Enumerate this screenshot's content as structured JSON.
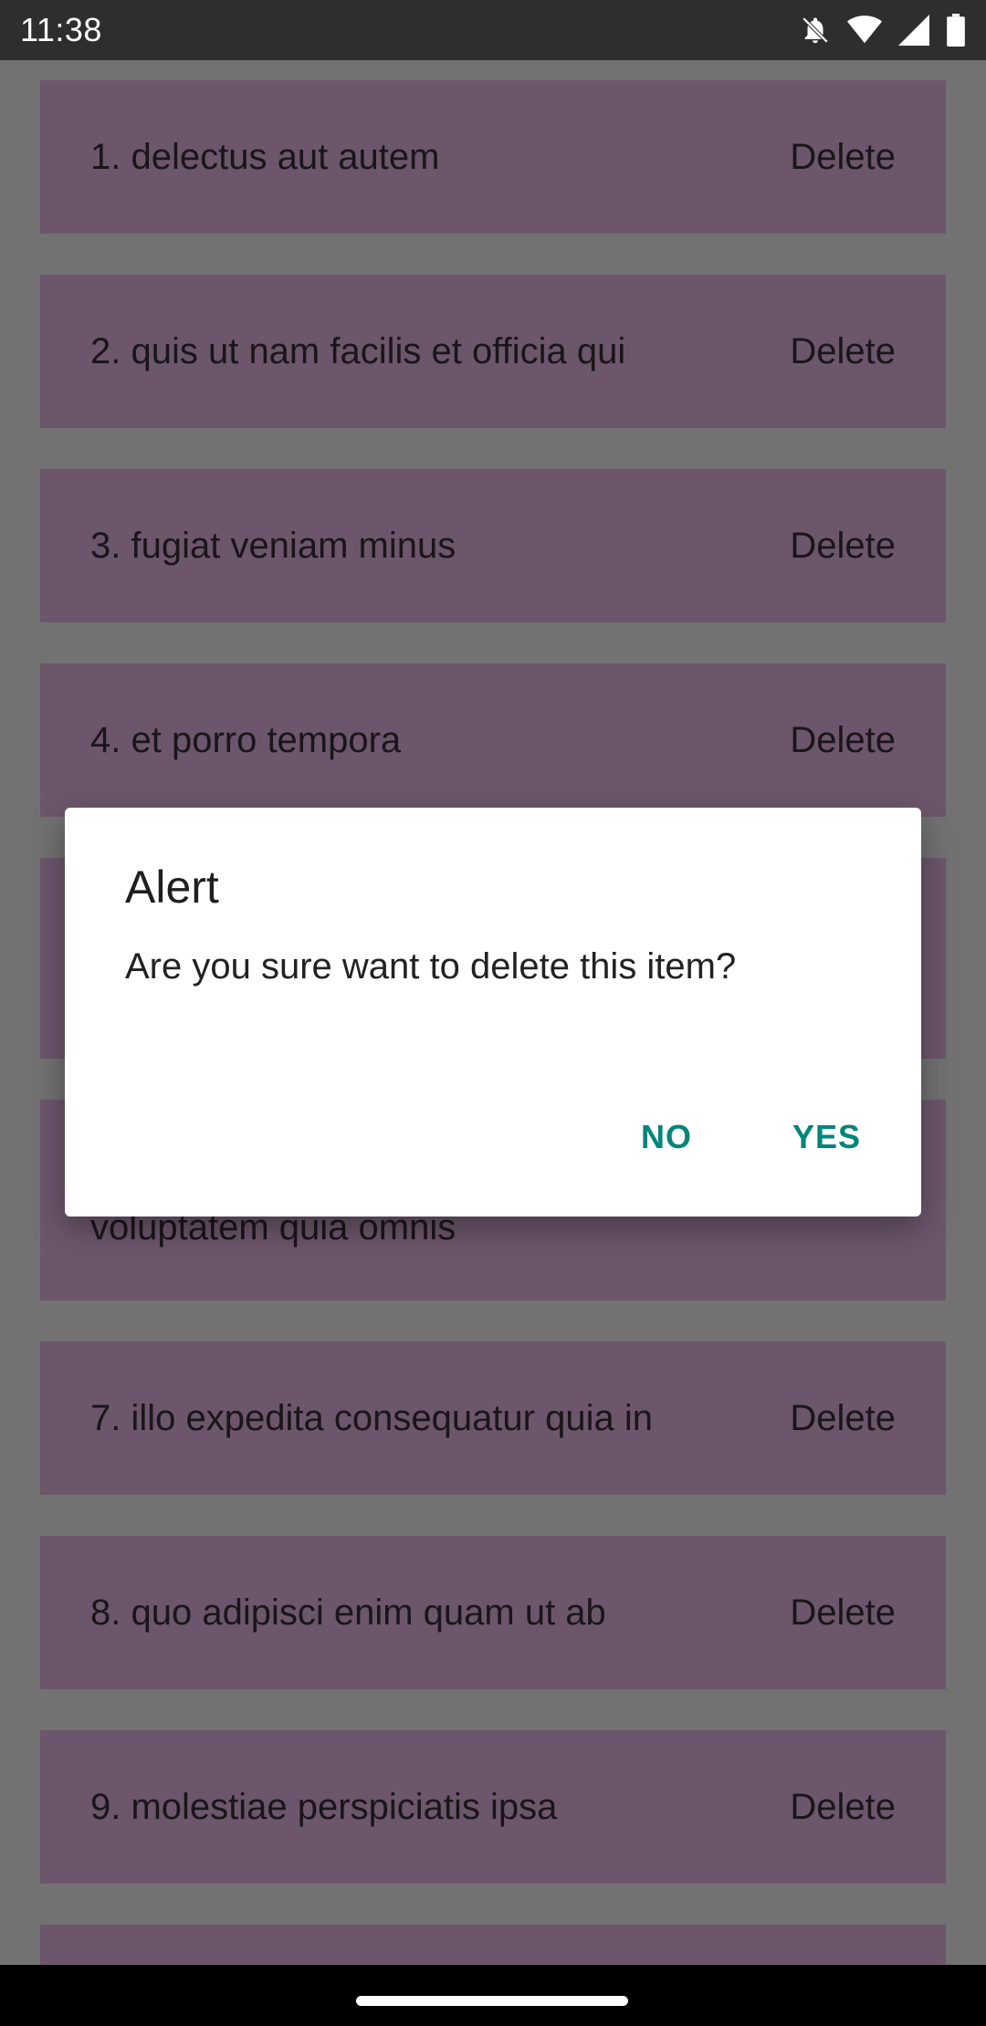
{
  "status_bar": {
    "time": "11:38",
    "icons": [
      "bell-off-icon",
      "wifi-icon",
      "signal-icon",
      "battery-icon"
    ]
  },
  "list": {
    "items": [
      {
        "label": "1. delectus aut autem",
        "action": "Delete"
      },
      {
        "label": "2. quis ut nam facilis et officia qui",
        "action": "Delete"
      },
      {
        "label": "3. fugiat veniam minus",
        "action": "Delete"
      },
      {
        "label": "4. et porro tempora",
        "action": "Delete"
      },
      {
        "label": "",
        "action": ""
      },
      {
        "label": "voluptatem quia omnis",
        "action": ""
      },
      {
        "label": "7. illo expedita consequatur quia in",
        "action": "Delete"
      },
      {
        "label": "8. quo adipisci enim quam ut ab",
        "action": "Delete"
      },
      {
        "label": "9. molestiae perspiciatis ipsa",
        "action": "Delete"
      },
      {
        "label": "",
        "action": ""
      }
    ]
  },
  "dialog": {
    "title": "Alert",
    "message": "Are you sure want to delete this item?",
    "no_label": "NO",
    "yes_label": "YES"
  },
  "colors": {
    "accent": "#00857a",
    "list_item_bg": "#6c566c",
    "scrim_bg": "#727272"
  }
}
